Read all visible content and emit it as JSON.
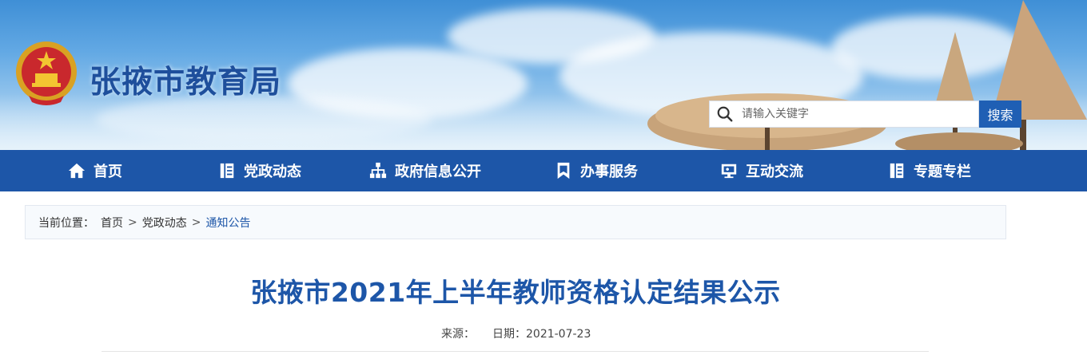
{
  "header": {
    "site_title": "张掖市教育局",
    "search_placeholder": "请输入关键字",
    "search_button": "搜索"
  },
  "nav": {
    "items": [
      {
        "label": "首页",
        "icon": "home-icon"
      },
      {
        "label": "党政动态",
        "icon": "news-icon"
      },
      {
        "label": "政府信息公开",
        "icon": "org-icon"
      },
      {
        "label": "办事服务",
        "icon": "bookmark-icon"
      },
      {
        "label": "互动交流",
        "icon": "monitor-icon"
      },
      {
        "label": "专题专栏",
        "icon": "column-icon"
      }
    ]
  },
  "breadcrumb": {
    "prefix": "当前位置：",
    "items": [
      "首页",
      "党政动态",
      "通知公告"
    ],
    "separator": ">"
  },
  "article": {
    "title": "张掖市2021年上半年教师资格认定结果公示",
    "source_label": "来源：",
    "date_label": "日期：2021-07-23"
  },
  "colors": {
    "nav_bg": "#1d56a8",
    "title_blue": "#1d56a8",
    "search_btn": "#1f5fb4"
  }
}
